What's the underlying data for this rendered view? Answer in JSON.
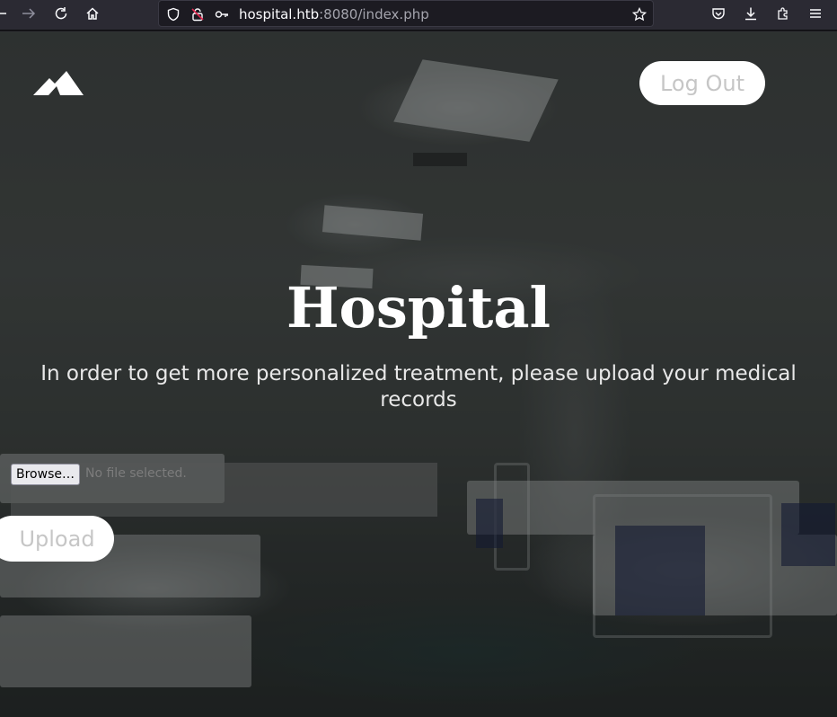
{
  "browser": {
    "url_host": "hospital.htb",
    "url_rest": ":8080/index.php",
    "icons": [
      "back-arrow-icon",
      "forward-arrow-icon",
      "reload-icon",
      "home-icon",
      "shield-icon",
      "insecure-lock-icon",
      "key-icon",
      "bookmark-star-icon",
      "pocket-icon",
      "download-icon",
      "extensions-icon",
      "menu-icon"
    ]
  },
  "page": {
    "logo": "mountain-logo-icon",
    "logout_label": "Log Out",
    "title": "Hospital",
    "subtitle": "In order to get more personalized treatment, please upload your medical records",
    "browse_label": "Browse…",
    "file_status": "No file selected.",
    "upload_label": "Upload"
  },
  "colors": {
    "button_bg": "#ffffff",
    "button_text": "#c6c6c6",
    "title": "#ffffff",
    "toolbar": "#2b2a33"
  }
}
